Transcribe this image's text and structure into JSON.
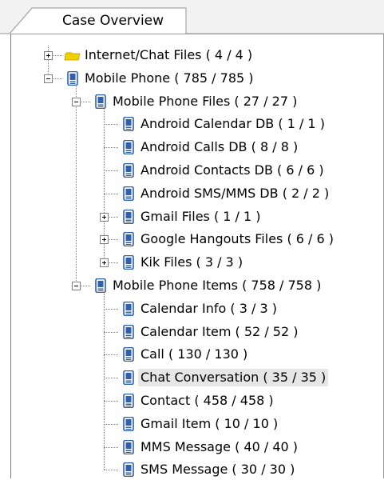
{
  "tab": {
    "label": "Case Overview"
  },
  "tree": [
    {
      "label": "Internet/Chat Files ( 4 / 4 )",
      "icon": "folder-icon",
      "expander": "plus"
    },
    {
      "label": "Mobile Phone ( 785 / 785 )",
      "icon": "mobile-phone-icon",
      "expander": "minus"
    },
    {
      "label": "Mobile Phone Files ( 27 / 27 )",
      "icon": "mobile-phone-icon",
      "expander": "minus"
    },
    {
      "label": "Android Calendar DB ( 1 / 1 )",
      "icon": "mobile-phone-icon"
    },
    {
      "label": "Android Calls DB ( 8 / 8 )",
      "icon": "mobile-phone-icon"
    },
    {
      "label": "Android Contacts DB ( 6 / 6 )",
      "icon": "mobile-phone-icon"
    },
    {
      "label": "Android SMS/MMS DB ( 2 / 2 )",
      "icon": "mobile-phone-icon"
    },
    {
      "label": "Gmail Files ( 1 / 1 )",
      "icon": "mobile-phone-icon",
      "expander": "plus"
    },
    {
      "label": "Google Hangouts Files ( 6 / 6 )",
      "icon": "mobile-phone-icon",
      "expander": "plus"
    },
    {
      "label": "Kik Files ( 3 / 3 )",
      "icon": "mobile-phone-icon",
      "expander": "plus"
    },
    {
      "label": "Mobile Phone Items ( 758 / 758 )",
      "icon": "mobile-phone-icon",
      "expander": "minus"
    },
    {
      "label": "Calendar Info ( 3 / 3 )",
      "icon": "mobile-phone-icon"
    },
    {
      "label": "Calendar Item ( 52 / 52 )",
      "icon": "mobile-phone-icon"
    },
    {
      "label": "Call ( 130 / 130 )",
      "icon": "mobile-phone-icon"
    },
    {
      "label": "Chat Conversation ( 35 / 35 )",
      "icon": "mobile-phone-icon",
      "selected": true
    },
    {
      "label": "Contact ( 458 / 458 )",
      "icon": "mobile-phone-icon"
    },
    {
      "label": "Gmail Item ( 10 / 10 )",
      "icon": "mobile-phone-icon"
    },
    {
      "label": "MMS Message ( 40 / 40 )",
      "icon": "mobile-phone-icon"
    },
    {
      "label": "SMS Message ( 30 / 30 )",
      "icon": "mobile-phone-icon"
    }
  ],
  "colors": {
    "phone_icon": "#2f5fb0",
    "folder_icon": "#f0d000",
    "selection": "#e6e6e6"
  }
}
